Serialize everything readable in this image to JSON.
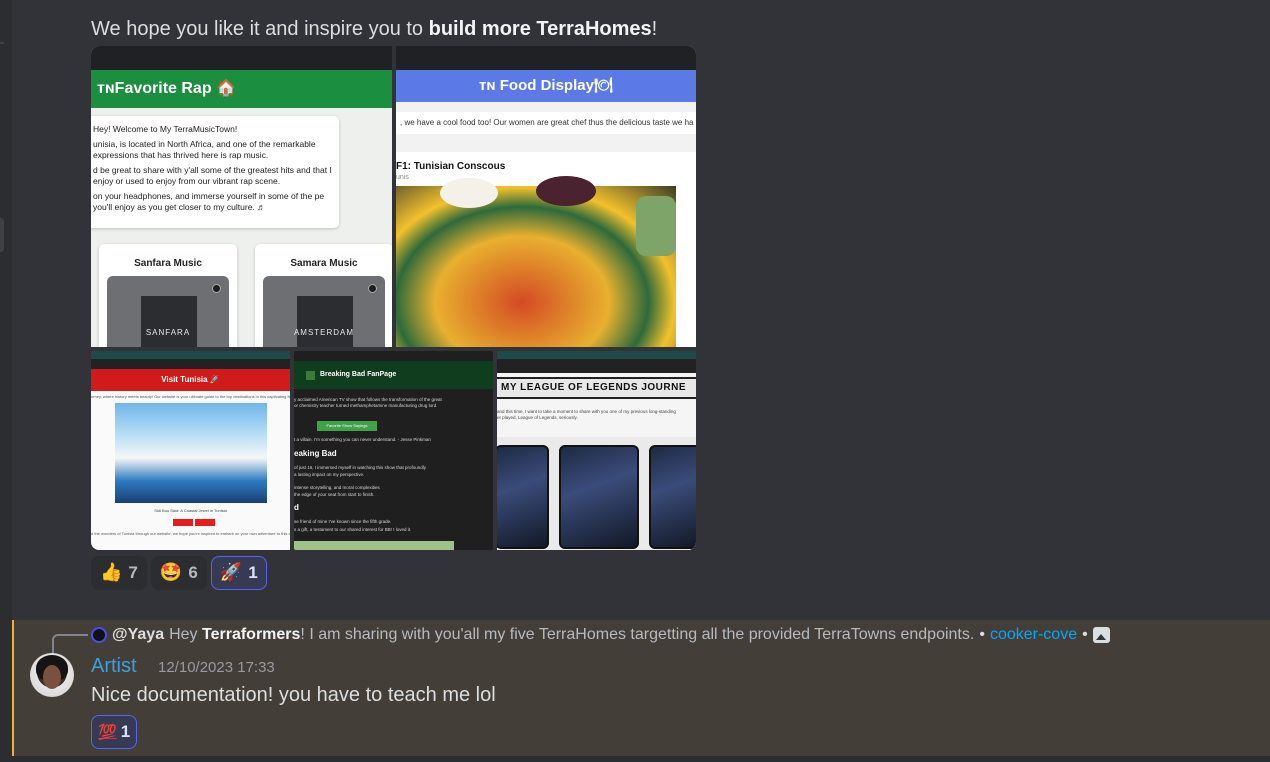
{
  "message": {
    "text_before": "We hope you like it and inspire you to ",
    "text_bold": "build more TerraHomes",
    "text_after": "!"
  },
  "gallery": {
    "rap": {
      "title": "ᴛɴFavorite Rap 🏠",
      "p1": "Hey! Welcome to My TerraMusicTown!",
      "p2": "unisia, is located in North Africa, and one of the remarkable expressions that has thrived here is rap music.",
      "p3": "d be great to share with y'all some of the greatest hits and that I enjoy or used to enjoy from our vibrant rap scene.",
      "p4": "on your headphones, and immerse yourself in some of the pe you'll enjoy as you get closer to my culture. ♬",
      "music1": "Sanfara Music",
      "music2": "Samara Music",
      "cover1": "SANFARA",
      "cover2": "AMSTERDAM"
    },
    "food": {
      "title": "ᴛɴ Food Display🍽",
      "sub": ", we have a cool food too! Our women are great chef thus the delicious taste we ha",
      "card_title": "F1: Tunisian Conscous",
      "card_sub": "unis"
    },
    "tunisia": {
      "title": "Visit Tunisia 🚀",
      "text": "urney, where history meets beauty! Our website is your ultimate guide to the top destinations in this captivating North Africa",
      "caption": "Sidi Bou Said: A Coastal Jewel in Tunisia",
      "foot": "d the wonders of Tunisia through our website, we hope you're inspired to embark on your own adventure to this captivating"
    },
    "breaking": {
      "title": "Breaking Bad FanPage",
      "l1": "y acclaimed American TV show that follows the transformation of the great",
      "l2": "or chemistry teacher turned methamphetamine manufacturing drug lord.",
      "quote": "t a villain. I'm something you can never understand. - Jesse Pinkman",
      "button": "Favorite Show Sayings",
      "h2": "eaking Bad",
      "l3": "of just 16, I immersed myself in watching this show that profoundly",
      "l4": "a lasting impact on my perspective.",
      "l5": "intense storytelling, and moral complexities",
      "l6": "the edge of your seat from start to finish.",
      "h3": "d",
      "l7": "se friend of mine I've known since the fifth grade.",
      "l8": "s a gift, a testament to our shared interest for BB! I loved it."
    },
    "lol": {
      "title": "MY LEAGUE OF LEGENDS JOURNE",
      "t1": "and this time, I want to take a moment to share with you one of my previous long-standing",
      "t2": "er played, League of Legends, seriously."
    }
  },
  "reactions": [
    {
      "emoji": "👍",
      "count": "7",
      "active": false
    },
    {
      "emoji": "🤩",
      "count": "6",
      "active": false
    },
    {
      "emoji": "🚀",
      "count": "1",
      "active": true
    }
  ],
  "reply": {
    "ref_user": "@Yaya",
    "ref_text_1": " Hey ",
    "ref_bold": "Terraformers",
    "ref_text_2": "! I am sharing with you'all my five TerraHomes targetting all the provided TerraTowns endpoints.",
    "bullet": " • ",
    "channel": "cooker-cove",
    "bullet2": " • ",
    "username": "Artist",
    "timestamp": "12/10/2023 17:33",
    "body": "Nice documentation! you have to teach me lol",
    "reaction_emoji": "💯",
    "reaction_count": "1"
  },
  "colors": {
    "background": "#313338",
    "highlight": "#433f38",
    "mention_bar": "#f0b132",
    "username": "#3ba0e0",
    "link": "#00a8fc",
    "active_reaction": "#5865f2"
  }
}
